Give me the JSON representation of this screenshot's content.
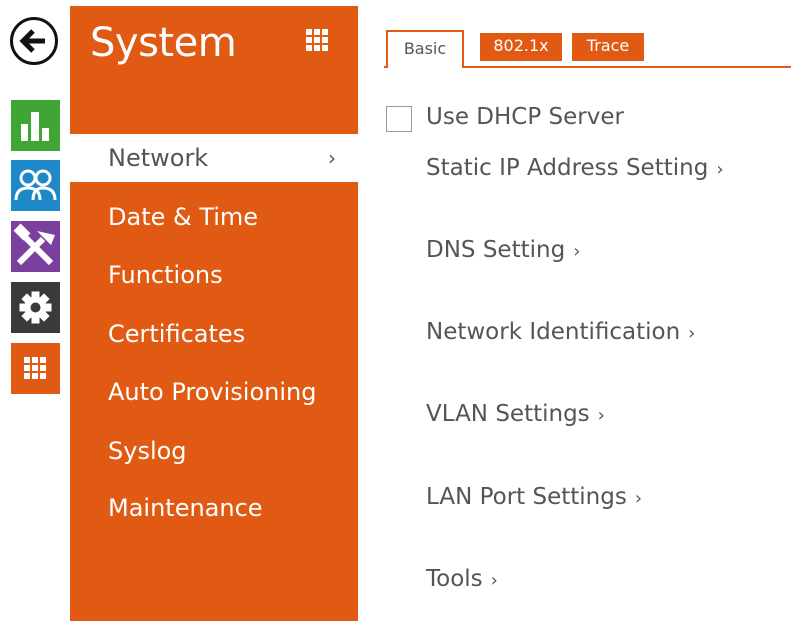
{
  "colors": {
    "accent": "#e05a14",
    "status_green": "#3fa535",
    "users_blue": "#1e88c9",
    "tools_purple": "#7b3f9e",
    "settings_dark": "#3a3a3a"
  },
  "rail": {
    "back": "back-arrow-icon",
    "items": [
      "status-chart-icon",
      "users-icon",
      "tools-icon",
      "settings-gear-icon",
      "apps-grid-icon"
    ]
  },
  "sidebar": {
    "title": "System",
    "grid_icon": "apps-grid-icon",
    "items": [
      {
        "label": "Network",
        "active": true,
        "chevron": "›"
      },
      {
        "label": "Date & Time"
      },
      {
        "label": "Functions"
      },
      {
        "label": "Certificates"
      },
      {
        "label": "Auto Provisioning"
      },
      {
        "label": "Syslog"
      },
      {
        "label": "Maintenance"
      }
    ]
  },
  "tabs": [
    {
      "label": "Basic",
      "active": true
    },
    {
      "label": "802.1x"
    },
    {
      "label": "Trace"
    }
  ],
  "content": {
    "dhcp": {
      "label": "Use DHCP Server",
      "checked": false
    },
    "sections": [
      {
        "label": "Static IP Address Setting",
        "arrow": "›"
      },
      {
        "label": "DNS Setting",
        "arrow": "›"
      },
      {
        "label": "Network Identification",
        "arrow": "›"
      },
      {
        "label": "VLAN Settings",
        "arrow": "›"
      },
      {
        "label": "LAN Port Settings",
        "arrow": "›"
      },
      {
        "label": "Tools",
        "arrow": "›"
      }
    ]
  }
}
